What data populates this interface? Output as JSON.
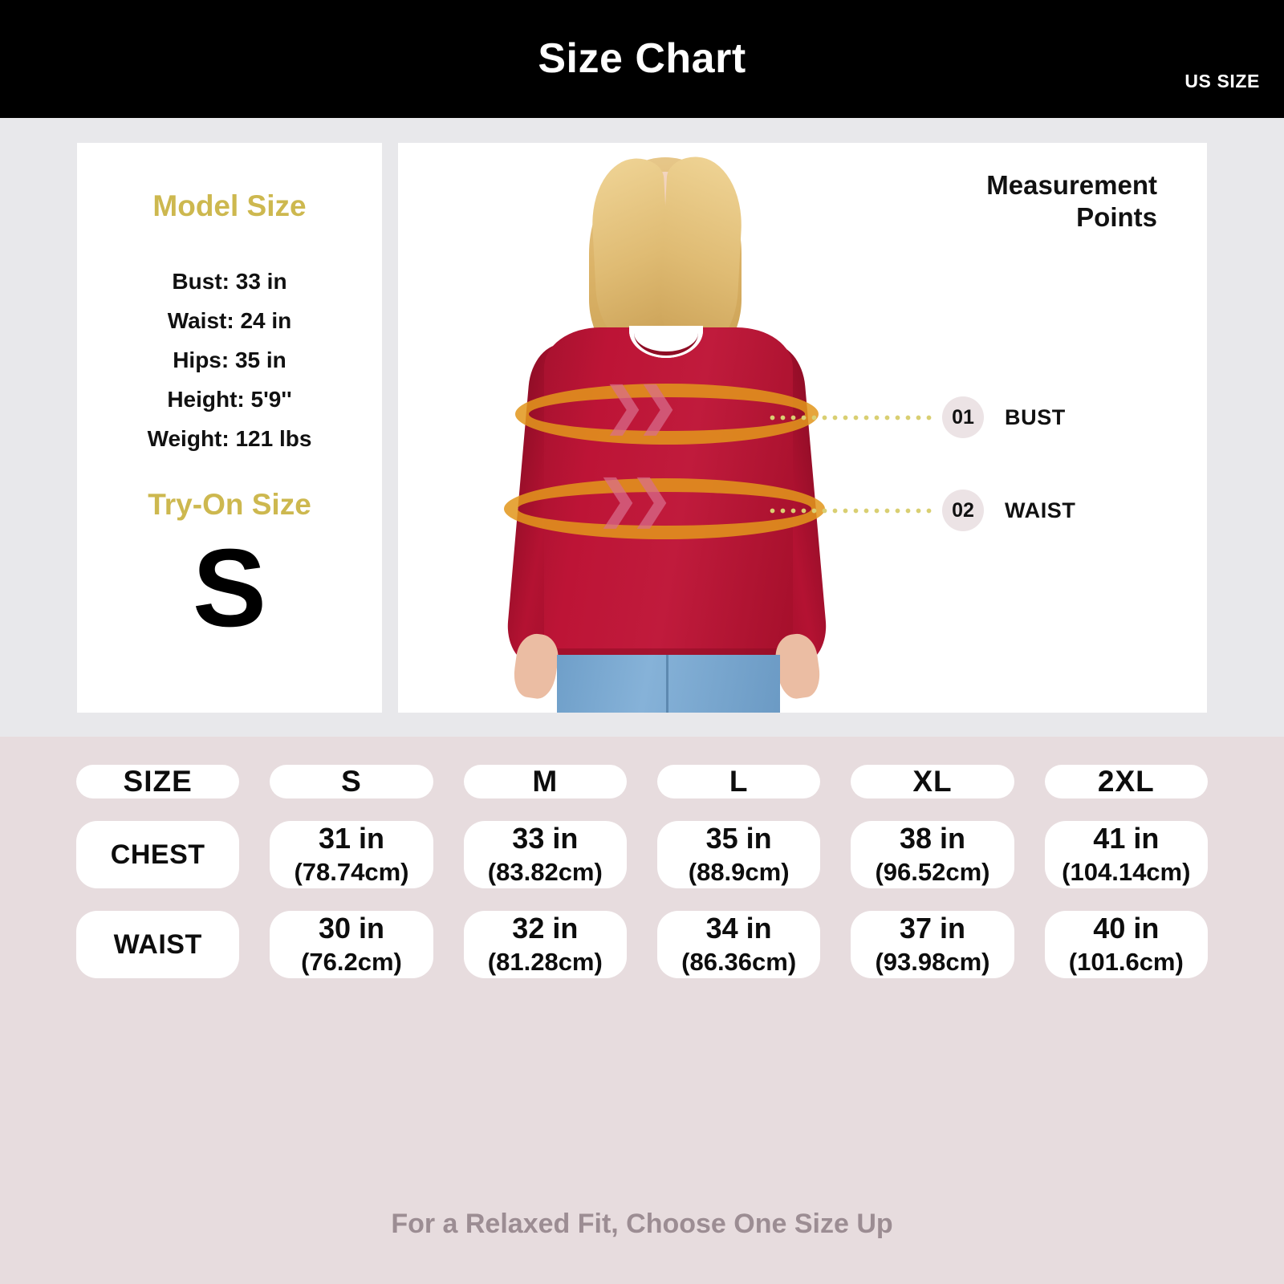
{
  "header": {
    "title": "Size Chart",
    "unit_badge": "US SIZE"
  },
  "model_panel": {
    "model_size_title": "Model Size",
    "stats": [
      "Bust: 33 in",
      "Waist: 24 in",
      "Hips: 35 in",
      "Height: 5'9''",
      "Weight: 121 lbs"
    ],
    "try_on_title": "Try-On Size",
    "try_on_value": "S"
  },
  "measurement_panel": {
    "title_line1": "Measurement",
    "title_line2": "Points",
    "points": [
      {
        "number": "01",
        "label": "BUST"
      },
      {
        "number": "02",
        "label": "WAIST"
      }
    ]
  },
  "size_table": {
    "header": [
      "SIZE",
      "S",
      "M",
      "L",
      "XL",
      "2XL"
    ],
    "rows": [
      {
        "label": "CHEST",
        "inches": [
          "31 in",
          "33 in",
          "35 in",
          "38 in",
          "41 in"
        ],
        "cm": [
          "(78.74cm)",
          "(83.82cm)",
          "(88.9cm)",
          "(96.52cm)",
          "(104.14cm)"
        ]
      },
      {
        "label": "WAIST",
        "inches": [
          "30 in",
          "32 in",
          "34 in",
          "37 in",
          "40 in"
        ],
        "cm": [
          "(76.2cm)",
          "(81.28cm)",
          "(86.36cm)",
          "(93.98cm)",
          "(101.6cm)"
        ]
      }
    ]
  },
  "footer": {
    "note": "For a Relaxed Fit, Choose One Size Up"
  },
  "colors": {
    "header_bg": "#000000",
    "accent_gold": "#cdb84f",
    "table_bg": "#e7dcde",
    "cell_bg": "#ffffff",
    "band": "#e2961c",
    "chevron": "#d86e8c",
    "footer_text": "#9c8d93",
    "shirt": "#bd1436"
  }
}
